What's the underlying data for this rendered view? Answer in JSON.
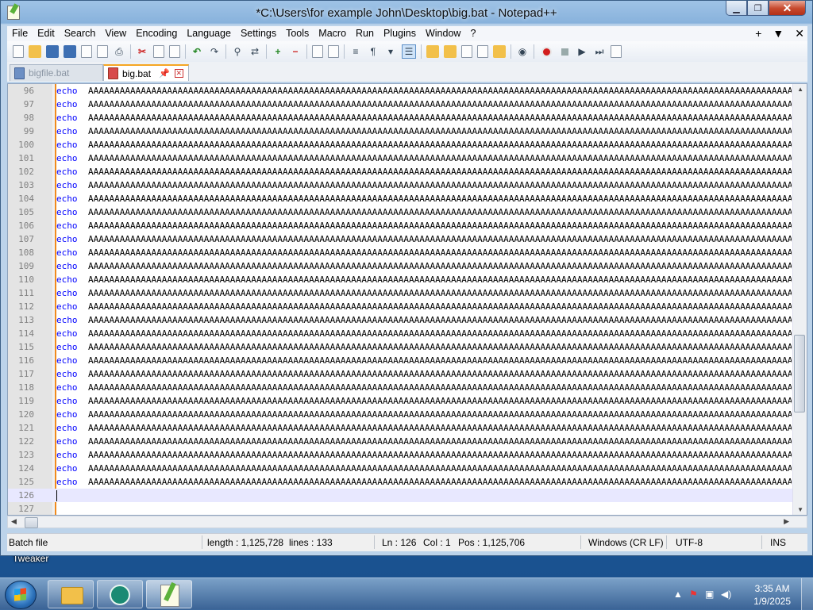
{
  "window": {
    "title": "*C:\\Users\\for example John\\Desktop\\big.bat - Notepad++",
    "controls": {
      "minimize": "▁",
      "maximize": "❐",
      "close": "✕"
    }
  },
  "menu": {
    "items": [
      "File",
      "Edit",
      "Search",
      "View",
      "Encoding",
      "Language",
      "Settings",
      "Tools",
      "Macro",
      "Run",
      "Plugins",
      "Window",
      "?"
    ],
    "right": [
      "+",
      "▼",
      "✕"
    ]
  },
  "tabs": [
    {
      "label": "bigfile.bat",
      "active": false
    },
    {
      "label": "big.bat",
      "active": true,
      "pin": "📌",
      "close": "✕"
    }
  ],
  "editor": {
    "keyword": "echo",
    "payload": "AAAAAAAAAAAAAAAAAAAAAAAAAAAAAAAAAAAAAAAAAAAAAAAAAAAAAAAAAAAAAAAAAAAAAAAAAAAAAAAAAAAAAAAAAAAAAAAAAAAAAAAAAAAAAAAAAAAAAAAAAAAAAAAAAAAAAAAAAAAAAAAAAAAAAAAAAAAAAAAAAAAAAAAAAAA",
    "lines": [
      {
        "n": "96",
        "kw": "echo"
      },
      {
        "n": "97",
        "kw": "echo"
      },
      {
        "n": "98",
        "kw": "echo"
      },
      {
        "n": "99",
        "kw": "echo"
      },
      {
        "n": "100",
        "kw": "echo"
      },
      {
        "n": "101",
        "kw": "echo"
      },
      {
        "n": "102",
        "kw": "echo"
      },
      {
        "n": "103",
        "kw": "echo"
      },
      {
        "n": "104",
        "kw": "echo"
      },
      {
        "n": "105",
        "kw": "echo"
      },
      {
        "n": "106",
        "kw": "echo"
      },
      {
        "n": "107",
        "kw": "echo"
      },
      {
        "n": "108",
        "kw": "echo"
      },
      {
        "n": "109",
        "kw": "echo"
      },
      {
        "n": "110",
        "kw": "echo"
      },
      {
        "n": "111",
        "kw": "echo"
      },
      {
        "n": "112",
        "kw": "echo"
      },
      {
        "n": "113",
        "kw": "echo"
      },
      {
        "n": "114",
        "kw": "echo"
      },
      {
        "n": "115",
        "kw": "echo"
      },
      {
        "n": "116",
        "kw": "echo"
      },
      {
        "n": "117",
        "kw": "echo"
      },
      {
        "n": "118",
        "kw": "echo"
      },
      {
        "n": "119",
        "kw": "echo"
      },
      {
        "n": "120",
        "kw": "echo"
      },
      {
        "n": "121",
        "kw": "echo"
      },
      {
        "n": "122",
        "kw": "echo"
      },
      {
        "n": "123",
        "kw": "echo"
      },
      {
        "n": "124",
        "kw": "echo"
      },
      {
        "n": "125",
        "kw": "echo"
      },
      {
        "n": "126",
        "kw": ""
      },
      {
        "n": "127",
        "kw": ""
      }
    ],
    "current_line": "126"
  },
  "status": {
    "language": "Batch file",
    "length": "length : 1,125,728",
    "lines": "lines : 133",
    "ln": "Ln : 126",
    "col": "Col : 1",
    "pos": "Pos : 1,125,706",
    "eol": "Windows (CR LF)",
    "encoding": "UTF-8",
    "mode": "INS"
  },
  "desktop": {
    "label": "Tweaker"
  },
  "taskbar": {
    "buttons": [
      "file-explorer",
      "edge-browser",
      "notepad-plus-plus"
    ],
    "clock_time": "3:35 AM",
    "clock_date": "1/9/2025"
  },
  "colors": {
    "keyword": "#0000ff",
    "line_number": "#808080",
    "current_line_bg": "#e8e8ff",
    "tab_accent": "#f5a623",
    "change_marker": "#f08a1d"
  }
}
